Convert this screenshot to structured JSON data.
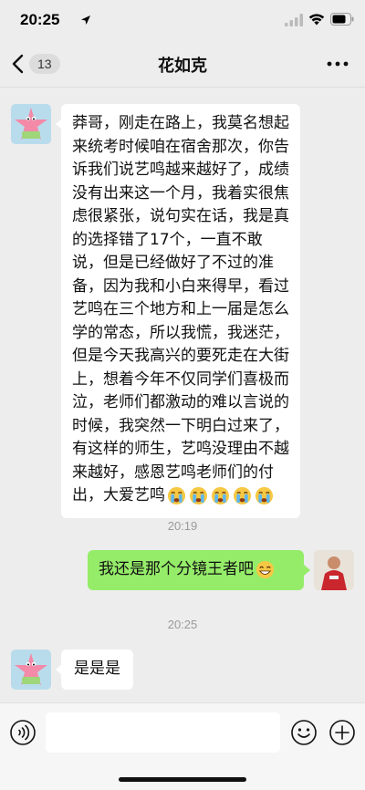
{
  "status_bar": {
    "time": "20:25"
  },
  "nav": {
    "back_count": "13",
    "title": "花如克"
  },
  "messages": [
    {
      "side": "left",
      "text": "莽哥，刚走在路上，我莫名想起来统考时候咱在宿舍那次，你告诉我们说艺鸣越来越好了，成绩没有出来这一个月，我着实很焦虑很紧张，说句实在话，我是真的选择错了17个，一直不敢说，但是已经做好了不过的准备，因为我和小白来得早，看过艺鸣在三个地方和上一届是怎么学的常态，所以我慌，我迷茫，但是今天我高兴的要死走在大街上，想着今年不仅同学们喜极而泣，老师们都激动的难以言说的时候，我突然一下明白过来了，有这样的师生，艺鸣没理由不越来越好，感恩艺鸣老师们的付出，大爱艺鸣",
      "emojis": [
        "crying-emoji",
        "crying-emoji",
        "crying-emoji",
        "crying-emoji",
        "crying-emoji"
      ]
    },
    {
      "time": "20:19"
    },
    {
      "side": "right",
      "text": "我还是那个分镜王者吧",
      "emojis": [
        "grin-emoji"
      ]
    },
    {
      "time": "20:25"
    },
    {
      "side": "left",
      "text": "是是是"
    }
  ],
  "colors": {
    "background": "#ededed",
    "bubble_self": "#95ec69",
    "bubble_other": "#ffffff"
  }
}
